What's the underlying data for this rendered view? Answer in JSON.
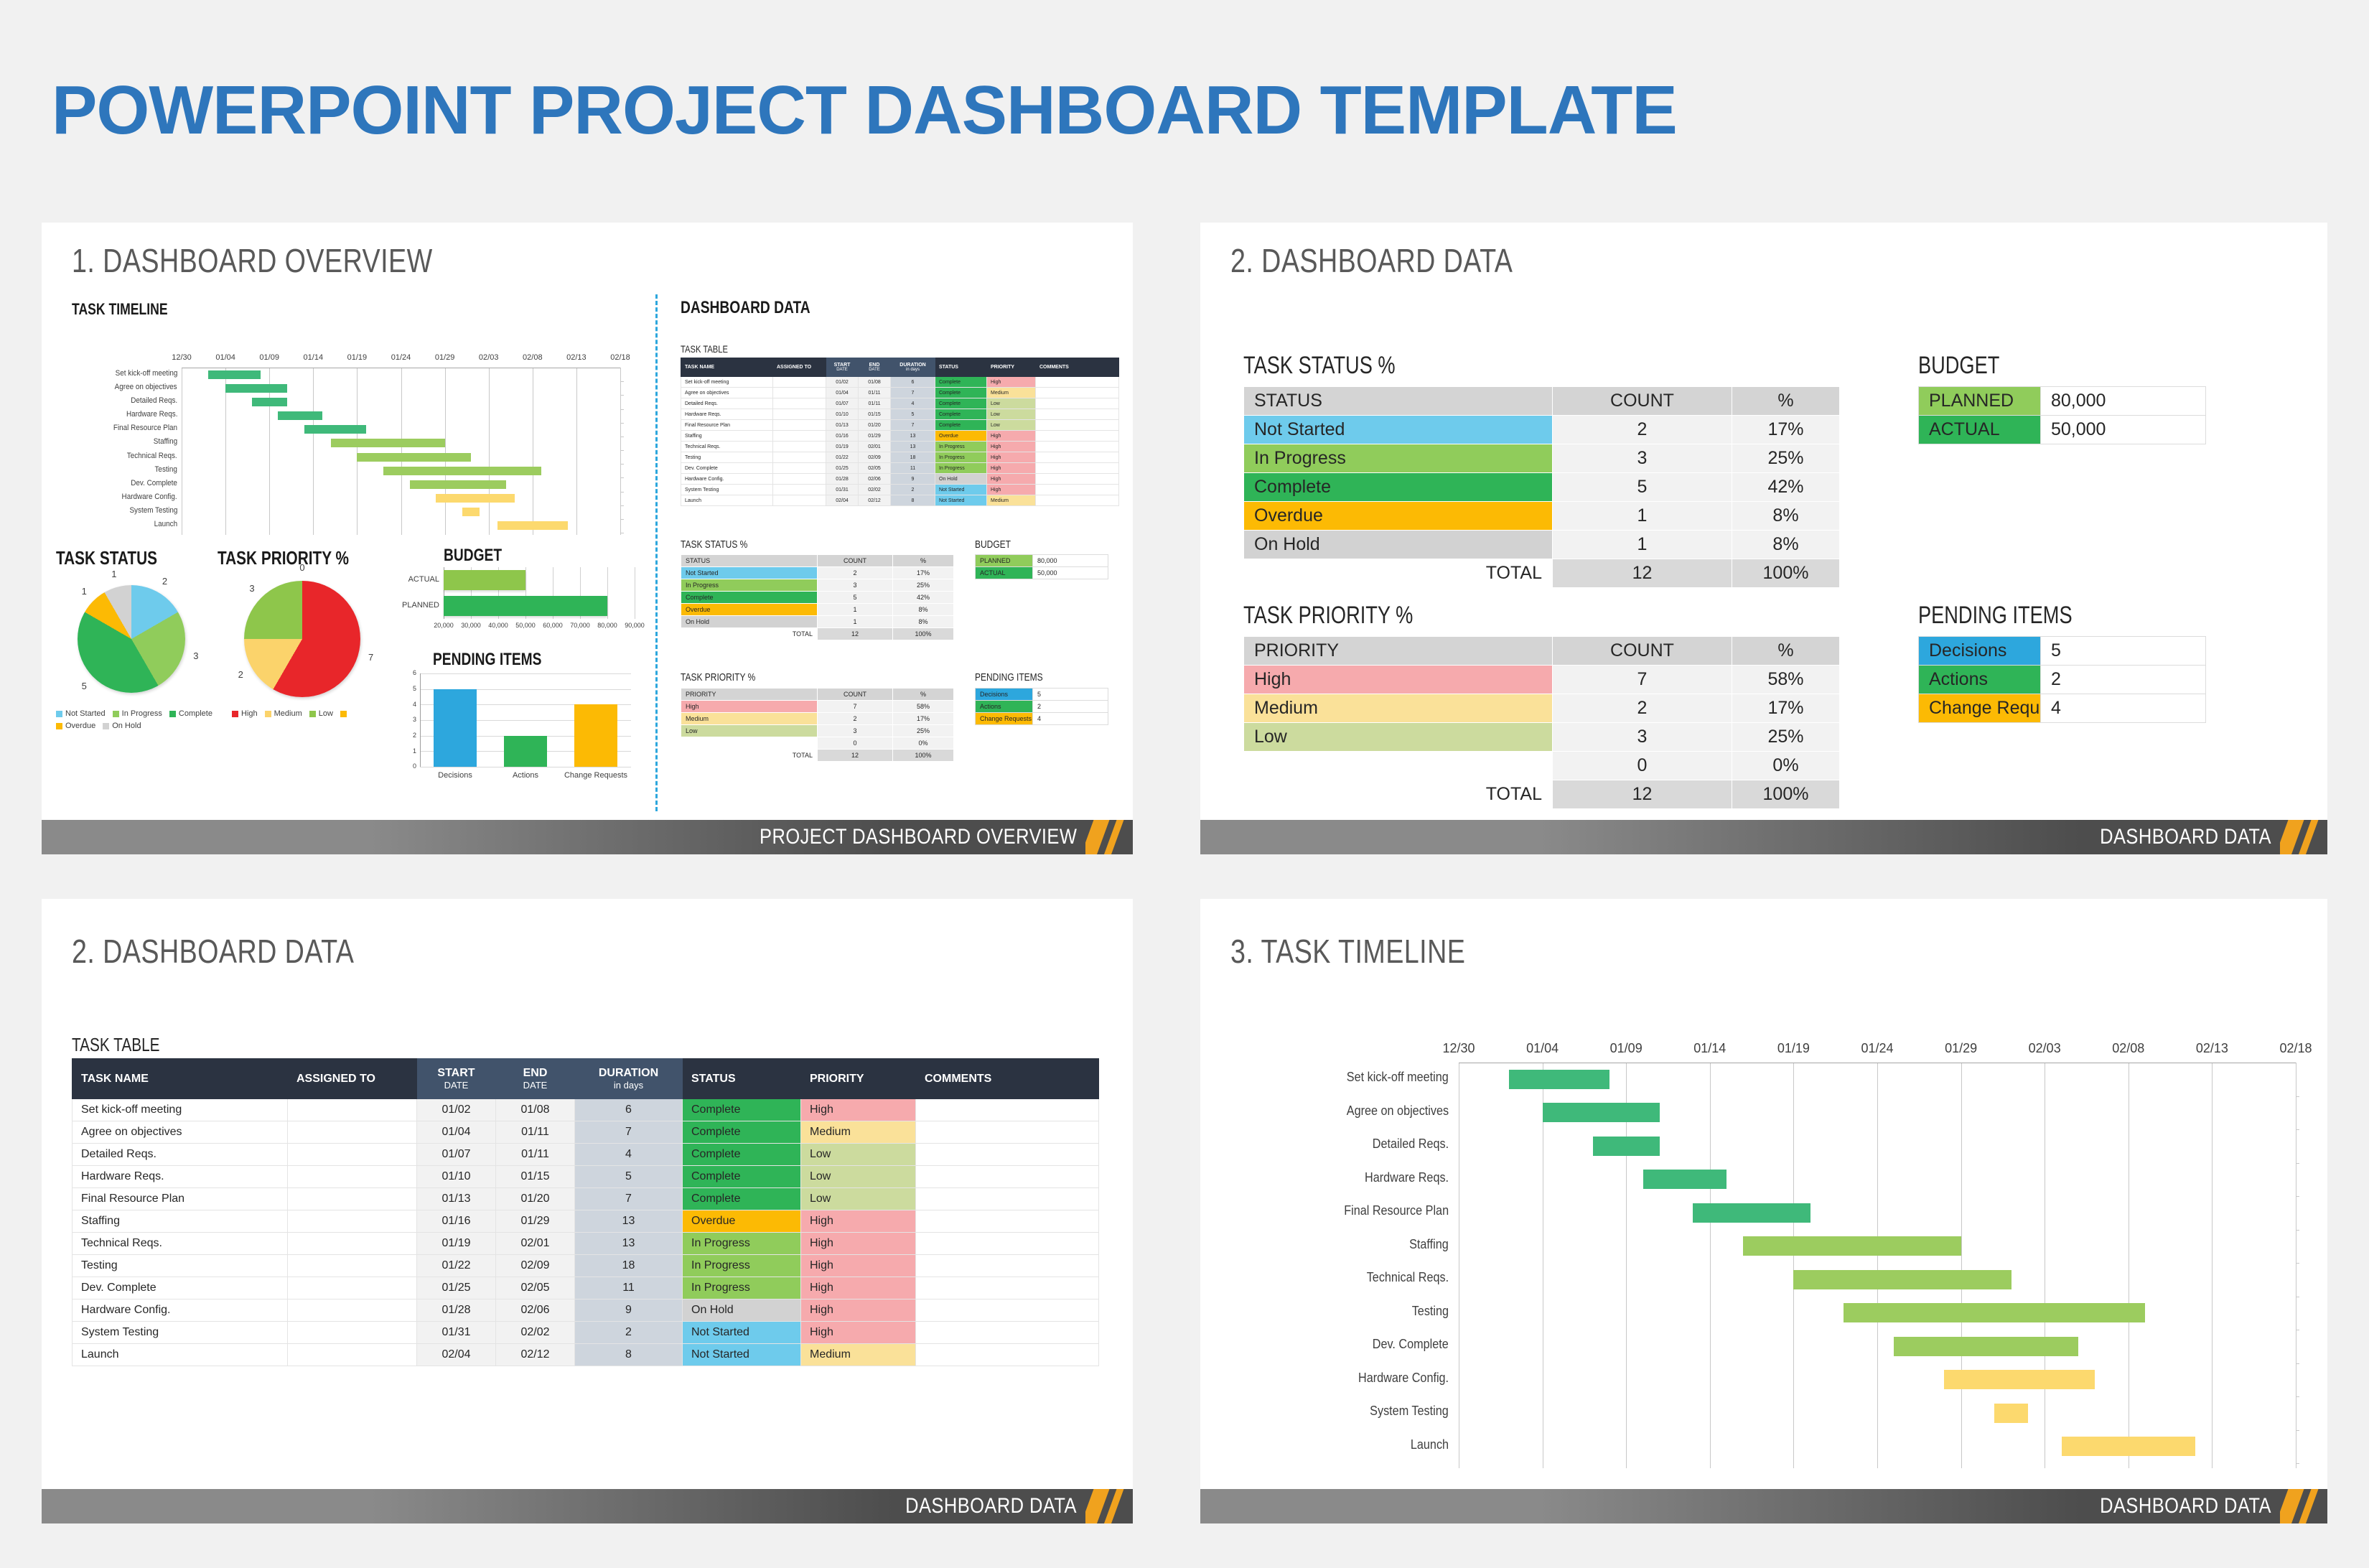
{
  "page_title": "POWERPOINT PROJECT DASHBOARD TEMPLATE",
  "theme": {
    "title_blue": "#2e76bc",
    "status_colors": {
      "Not Started": "#6ecbec",
      "In Progress": "#90cc5b",
      "Complete": "#2fb457",
      "Overdue": "#fcba04",
      "On Hold": "#d2d2d2"
    },
    "priority_colors": {
      "High": "#f6aaad",
      "Medium": "#fae199",
      "Low": "#ccdb9e"
    },
    "pending_colors": {
      "Decisions": "#2da7dd",
      "Actions": "#2fb457",
      "Change Requests": "#fcba04"
    },
    "budget_colors": {
      "PLANNED": "#90cc5b",
      "ACTUAL": "#2fb457"
    }
  },
  "slide1": {
    "title": "1. DASHBOARD OVERVIEW",
    "footer": "PROJECT DASHBOARD OVERVIEW",
    "heading_timeline": "TASK TIMELINE",
    "heading_dashboard_data": "DASHBOARD DATA",
    "heading_task_table": "TASK TABLE",
    "heading_task_status_pie": "TASK STATUS",
    "heading_task_priority_pie": "TASK PRIORITY %",
    "heading_budget_chart": "BUDGET",
    "heading_pending_chart": "PENDING ITEMS",
    "heading_task_status_tbl": "TASK STATUS %",
    "heading_task_priority_tbl": "TASK PRIORITY %",
    "heading_budget_tbl": "BUDGET",
    "heading_pending_tbl": "PENDING ITEMS"
  },
  "slide2": {
    "title": "2. DASHBOARD DATA",
    "footer": "DASHBOARD DATA",
    "heading_task_status": "TASK STATUS %",
    "heading_task_priority": "TASK PRIORITY %",
    "heading_budget": "BUDGET",
    "heading_pending": "PENDING ITEMS"
  },
  "slide3": {
    "title": "2. DASHBOARD DATA",
    "footer": "DASHBOARD DATA",
    "heading_task_table": "TASK TABLE"
  },
  "slide4": {
    "title": "3. TASK TIMELINE",
    "footer": "DASHBOARD DATA"
  },
  "task_table": {
    "columns": [
      {
        "label": "TASK NAME",
        "sub": ""
      },
      {
        "label": "ASSIGNED TO",
        "sub": ""
      },
      {
        "label": "START",
        "sub": "DATE"
      },
      {
        "label": "END",
        "sub": "DATE"
      },
      {
        "label": "DURATION",
        "sub": "in days"
      },
      {
        "label": "STATUS",
        "sub": ""
      },
      {
        "label": "PRIORITY",
        "sub": ""
      },
      {
        "label": "COMMENTS",
        "sub": ""
      }
    ],
    "rows": [
      {
        "task": "Set kick-off meeting",
        "assigned": "",
        "start": "01/02",
        "end": "01/08",
        "duration": "6",
        "status": "Complete",
        "priority": "High",
        "comments": ""
      },
      {
        "task": "Agree on objectives",
        "assigned": "",
        "start": "01/04",
        "end": "01/11",
        "duration": "7",
        "status": "Complete",
        "priority": "Medium",
        "comments": ""
      },
      {
        "task": "Detailed Reqs.",
        "assigned": "",
        "start": "01/07",
        "end": "01/11",
        "duration": "4",
        "status": "Complete",
        "priority": "Low",
        "comments": ""
      },
      {
        "task": "Hardware Reqs.",
        "assigned": "",
        "start": "01/10",
        "end": "01/15",
        "duration": "5",
        "status": "Complete",
        "priority": "Low",
        "comments": ""
      },
      {
        "task": "Final Resource Plan",
        "assigned": "",
        "start": "01/13",
        "end": "01/20",
        "duration": "7",
        "status": "Complete",
        "priority": "Low",
        "comments": ""
      },
      {
        "task": "Staffing",
        "assigned": "",
        "start": "01/16",
        "end": "01/29",
        "duration": "13",
        "status": "Overdue",
        "priority": "High",
        "comments": ""
      },
      {
        "task": "Technical Reqs.",
        "assigned": "",
        "start": "01/19",
        "end": "02/01",
        "duration": "13",
        "status": "In Progress",
        "priority": "High",
        "comments": ""
      },
      {
        "task": "Testing",
        "assigned": "",
        "start": "01/22",
        "end": "02/09",
        "duration": "18",
        "status": "In Progress",
        "priority": "High",
        "comments": ""
      },
      {
        "task": "Dev. Complete",
        "assigned": "",
        "start": "01/25",
        "end": "02/05",
        "duration": "11",
        "status": "In Progress",
        "priority": "High",
        "comments": ""
      },
      {
        "task": "Hardware Config.",
        "assigned": "",
        "start": "01/28",
        "end": "02/06",
        "duration": "9",
        "status": "On Hold",
        "priority": "High",
        "comments": ""
      },
      {
        "task": "System Testing",
        "assigned": "",
        "start": "01/31",
        "end": "02/02",
        "duration": "2",
        "status": "Not Started",
        "priority": "High",
        "comments": ""
      },
      {
        "task": "Launch",
        "assigned": "",
        "start": "02/04",
        "end": "02/12",
        "duration": "8",
        "status": "Not Started",
        "priority": "Medium",
        "comments": ""
      }
    ]
  },
  "task_status_table": {
    "columns": [
      "STATUS",
      "COUNT",
      "%"
    ],
    "rows": [
      {
        "label": "Not Started",
        "count": "2",
        "pct": "17%"
      },
      {
        "label": "In Progress",
        "count": "3",
        "pct": "25%"
      },
      {
        "label": "Complete",
        "count": "5",
        "pct": "42%"
      },
      {
        "label": "Overdue",
        "count": "1",
        "pct": "8%"
      },
      {
        "label": "On Hold",
        "count": "1",
        "pct": "8%"
      }
    ],
    "total": {
      "label": "TOTAL",
      "count": "12",
      "pct": "100%"
    }
  },
  "task_priority_table": {
    "columns": [
      "PRIORITY",
      "COUNT",
      "%"
    ],
    "rows": [
      {
        "label": "High",
        "count": "7",
        "pct": "58%"
      },
      {
        "label": "Medium",
        "count": "2",
        "pct": "17%"
      },
      {
        "label": "Low",
        "count": "3",
        "pct": "25%"
      },
      {
        "label": "",
        "count": "0",
        "pct": "0%"
      }
    ],
    "total": {
      "label": "TOTAL",
      "count": "12",
      "pct": "100%"
    }
  },
  "budget_table": {
    "rows": [
      {
        "label": "PLANNED",
        "value": "80,000"
      },
      {
        "label": "ACTUAL",
        "value": "50,000"
      }
    ]
  },
  "pending_table": {
    "rows": [
      {
        "label": "Decisions",
        "value": "5"
      },
      {
        "label": "Actions",
        "value": "2"
      },
      {
        "label": "Change Requests",
        "value": "4"
      }
    ]
  },
  "chart_data": [
    {
      "type": "pie",
      "title": "TASK STATUS",
      "categories": [
        "Not Started",
        "In Progress",
        "Complete",
        "Overdue",
        "On Hold"
      ],
      "values": [
        2,
        3,
        5,
        1,
        1
      ],
      "data_labels": [
        "2",
        "3",
        "5",
        "1",
        "1"
      ],
      "colors": [
        "#6ecbec",
        "#90cc5b",
        "#2fb457",
        "#fcba04",
        "#d2d2d2"
      ],
      "legend": [
        "Not Started",
        "In Progress",
        "Complete",
        "Overdue",
        "On Hold"
      ],
      "legend_position": "bottom"
    },
    {
      "type": "pie",
      "title": "TASK PRIORITY %",
      "categories": [
        "High",
        "Medium",
        "Low",
        ""
      ],
      "values": [
        7,
        2,
        3,
        0
      ],
      "data_labels": [
        "7",
        "2",
        "3",
        "0"
      ],
      "colors": [
        "#e8262a",
        "#fbd36b",
        "#8ec64b",
        "#fcba04"
      ],
      "legend": [
        "High",
        "Medium",
        "Low",
        ""
      ],
      "legend_position": "bottom"
    },
    {
      "type": "bar",
      "orientation": "horizontal",
      "title": "BUDGET",
      "categories": [
        "ACTUAL",
        "PLANNED"
      ],
      "values": [
        50000,
        80000
      ],
      "colors": [
        "#8ec64b",
        "#2fb457"
      ],
      "xlabel": "",
      "ylabel": "",
      "xlim": [
        20000,
        90000
      ],
      "xticks": [
        "20,000",
        "30,000",
        "40,000",
        "50,000",
        "60,000",
        "70,000",
        "80,000",
        "90,000"
      ],
      "grid": true
    },
    {
      "type": "bar",
      "orientation": "vertical",
      "title": "PENDING ITEMS",
      "categories": [
        "Decisions",
        "Actions",
        "Change Requests"
      ],
      "values": [
        5,
        2,
        4
      ],
      "colors": [
        "#2da7dd",
        "#2fb457",
        "#fcba04"
      ],
      "xlabel": "",
      "ylabel": "",
      "ylim": [
        0,
        6
      ],
      "yticks": [
        "0",
        "1",
        "2",
        "3",
        "4",
        "5",
        "6"
      ],
      "grid": true
    },
    {
      "type": "gantt",
      "title": "TASK TIMELINE",
      "xticks": [
        "12/30",
        "01/04",
        "01/09",
        "01/14",
        "01/19",
        "01/24",
        "01/29",
        "02/03",
        "02/08",
        "02/13",
        "02/18"
      ],
      "xlim": [
        "12/30",
        "02/18"
      ],
      "categories": [
        "Set kick-off meeting",
        "Agree on objectives",
        "Detailed Reqs.",
        "Hardware Reqs.",
        "Final Resource Plan",
        "Staffing",
        "Technical Reqs.",
        "Testing",
        "Dev. Complete",
        "Hardware Config.",
        "System Testing",
        "Launch"
      ],
      "bars": [
        {
          "task": "Set kick-off meeting",
          "start": "01/02",
          "end": "01/08",
          "duration": 6,
          "color": "#3fb97a"
        },
        {
          "task": "Agree on objectives",
          "start": "01/04",
          "end": "01/11",
          "duration": 7,
          "color": "#3fb97a"
        },
        {
          "task": "Detailed Reqs.",
          "start": "01/07",
          "end": "01/11",
          "duration": 4,
          "color": "#3fb97a"
        },
        {
          "task": "Hardware Reqs.",
          "start": "01/10",
          "end": "01/15",
          "duration": 5,
          "color": "#3fb97a"
        },
        {
          "task": "Final Resource Plan",
          "start": "01/13",
          "end": "01/20",
          "duration": 7,
          "color": "#3fb97a"
        },
        {
          "task": "Staffing",
          "start": "01/16",
          "end": "01/29",
          "duration": 13,
          "color": "#9ccc5f"
        },
        {
          "task": "Technical Reqs.",
          "start": "01/19",
          "end": "02/01",
          "duration": 13,
          "color": "#9ccc5f"
        },
        {
          "task": "Testing",
          "start": "01/22",
          "end": "02/09",
          "duration": 18,
          "color": "#9ccc5f"
        },
        {
          "task": "Dev. Complete",
          "start": "01/25",
          "end": "02/05",
          "duration": 11,
          "color": "#9ccc5f"
        },
        {
          "task": "Hardware Config.",
          "start": "01/28",
          "end": "02/06",
          "duration": 9,
          "color": "#fcd96e"
        },
        {
          "task": "System Testing",
          "start": "01/31",
          "end": "02/02",
          "duration": 2,
          "color": "#fcd96e"
        },
        {
          "task": "Launch",
          "start": "02/04",
          "end": "02/12",
          "duration": 8,
          "color": "#fcd96e"
        }
      ]
    }
  ]
}
